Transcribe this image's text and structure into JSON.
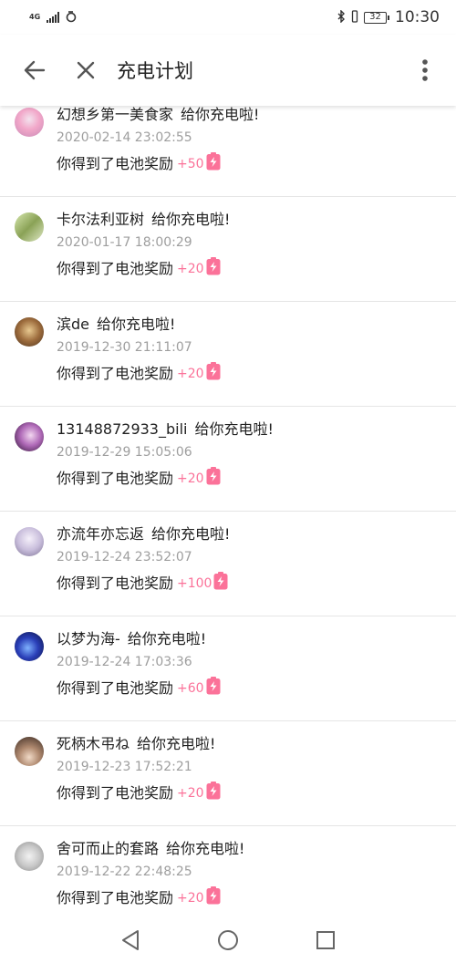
{
  "status_bar": {
    "network": "4G",
    "carrier_icon": "sync-icon",
    "battery": "32",
    "time": "10:30"
  },
  "header": {
    "title": "充电计划"
  },
  "colors": {
    "accent": "#fb7299",
    "secondary_text": "#9e9e9e"
  },
  "records": [
    {
      "user": "幻想乡第一美食家",
      "action": "给你充电啦!",
      "time": "2020-02-14 23:02:55",
      "reward_label": "你得到了电池奖励",
      "amount": "+50"
    },
    {
      "user": "卡尔法利亚树",
      "action": "给你充电啦!",
      "time": "2020-01-17 18:00:29",
      "reward_label": "你得到了电池奖励",
      "amount": "+20"
    },
    {
      "user": "滨de",
      "action": "给你充电啦!",
      "time": "2019-12-30 21:11:07",
      "reward_label": "你得到了电池奖励",
      "amount": "+20"
    },
    {
      "user": "13148872933_bili",
      "action": "给你充电啦!",
      "time": "2019-12-29 15:05:06",
      "reward_label": "你得到了电池奖励",
      "amount": "+20"
    },
    {
      "user": "亦流年亦忘返",
      "action": "给你充电啦!",
      "time": "2019-12-24 23:52:07",
      "reward_label": "你得到了电池奖励",
      "amount": "+100"
    },
    {
      "user": "以梦为海-",
      "action": "给你充电啦!",
      "time": "2019-12-24 17:03:36",
      "reward_label": "你得到了电池奖励",
      "amount": "+60"
    },
    {
      "user": "死柄木弔ね",
      "action": "给你充电啦!",
      "time": "2019-12-23 17:52:21",
      "reward_label": "你得到了电池奖励",
      "amount": "+20"
    },
    {
      "user": "舍可而止的套路",
      "action": "给你充电啦!",
      "time": "2019-12-22 22:48:25",
      "reward_label": "你得到了电池奖励",
      "amount": "+20"
    }
  ]
}
